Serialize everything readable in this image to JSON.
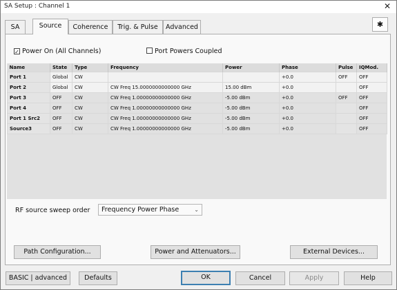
{
  "window": {
    "title": "SA Setup : Channel 1",
    "close_glyph": "✕"
  },
  "tabs": [
    {
      "label": "SA"
    },
    {
      "label": "Source"
    },
    {
      "label": "Coherence"
    },
    {
      "label": "Trig. & Pulse"
    },
    {
      "label": "Advanced"
    }
  ],
  "active_tab": "Source",
  "gear_glyph": "✱",
  "checkboxes": {
    "power_on": {
      "label": "Power On (All Channels)",
      "checked": true
    },
    "port_powers_coupled": {
      "label": "Port Powers Coupled",
      "checked": false
    }
  },
  "table": {
    "headers": [
      "Name",
      "State",
      "Type",
      "Frequency",
      "Power",
      "Phase",
      "Pulse",
      "IQMod."
    ],
    "rows": [
      [
        "Port 1",
        "Global",
        "CW",
        "",
        "",
        "+0.0",
        "OFF",
        "OFF"
      ],
      [
        "Port 2",
        "Global",
        "CW",
        "CW Freq 15.0000000000000 GHz",
        "15.00 dBm",
        "+0.0",
        "",
        "OFF"
      ],
      [
        "Port 3",
        "OFF",
        "CW",
        "CW Freq 1.00000000000000 GHz",
        "-5.00 dBm",
        "+0.0",
        "OFF",
        "OFF"
      ],
      [
        "Port 4",
        "OFF",
        "CW",
        "CW Freq 1.00000000000000 GHz",
        "-5.00 dBm",
        "+0.0",
        "",
        "OFF"
      ],
      [
        "Port 1 Src2",
        "OFF",
        "CW",
        "CW Freq 1.00000000000000 GHz",
        "-5.00 dBm",
        "+0.0",
        "",
        "OFF"
      ],
      [
        "Source3",
        "OFF",
        "CW",
        "CW Freq 1.00000000000000 GHz",
        "-5.00 dBm",
        "+0.0",
        "",
        "OFF"
      ]
    ]
  },
  "sweep_order": {
    "label": "RF source sweep order",
    "value": "Frequency Power Phase"
  },
  "buttons": {
    "path_config": "Path Configuration...",
    "power_atten": "Power and Attenuators...",
    "external_devices": "External Devices...",
    "basic_advanced": "BASIC | advanced",
    "defaults": "Defaults",
    "ok": "OK",
    "cancel": "Cancel",
    "apply": "Apply",
    "help": "Help"
  }
}
